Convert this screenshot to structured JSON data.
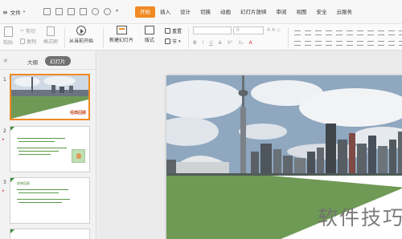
{
  "menubar": {
    "file_label": "文件",
    "tabs": [
      {
        "label": "开始",
        "active": true
      },
      {
        "label": "插入",
        "active": false
      },
      {
        "label": "设计",
        "active": false
      },
      {
        "label": "切换",
        "active": false
      },
      {
        "label": "动画",
        "active": false
      },
      {
        "label": "幻灯片放映",
        "active": false
      },
      {
        "label": "审阅",
        "active": false
      },
      {
        "label": "视图",
        "active": false
      },
      {
        "label": "安全",
        "active": false
      },
      {
        "label": "云服务",
        "active": false
      }
    ],
    "accent_color": "#f08a24"
  },
  "ribbon": {
    "paste_label": "粘贴",
    "cut_label": "剪切",
    "copy_label": "复制",
    "format_painter_label": "格式刷",
    "from_current_label": "从当前开始",
    "new_slide_label": "新建幻灯片",
    "layout_label": "版式",
    "reset_label": "重置",
    "section_label": "节",
    "font_size_value": "0"
  },
  "panel": {
    "outline_tab": "大纲",
    "slides_tab": "幻灯片",
    "thumbnails": [
      {
        "number": "1",
        "title": "经典回顾"
      },
      {
        "number": "2"
      },
      {
        "number": "3",
        "heading": "经典回顾"
      }
    ]
  },
  "slide": {
    "watermark": "软件技巧",
    "accent_green": "#6f9a55"
  }
}
